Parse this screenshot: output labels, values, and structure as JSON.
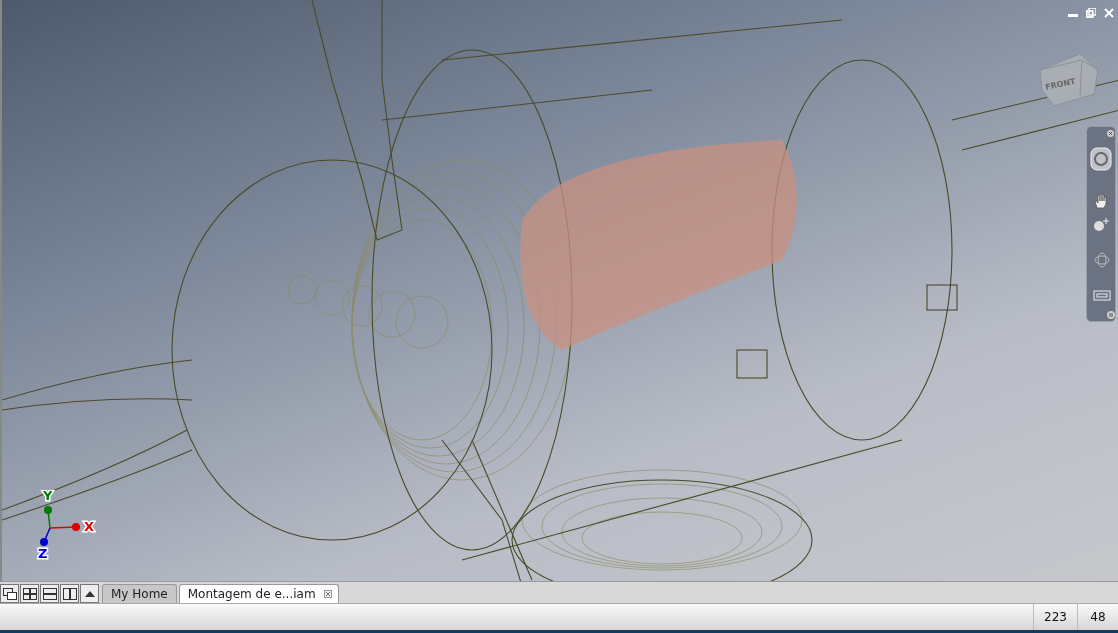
{
  "viewport": {
    "view_cube": {
      "face_label": "FRONT"
    },
    "axis_triad": [
      {
        "kind": "x",
        "label": "X",
        "color": "#e00000"
      },
      {
        "kind": "y",
        "label": "Y",
        "color": "#007a00"
      },
      {
        "kind": "z",
        "label": "Z",
        "color": "#0000d0"
      }
    ]
  },
  "document_tabs": [
    {
      "label": "My Home",
      "selected": false,
      "closable": false
    },
    {
      "label": "Montagem de e...iam",
      "selected": true,
      "closable": true
    }
  ],
  "status_bar": [
    "223",
    "48"
  ]
}
